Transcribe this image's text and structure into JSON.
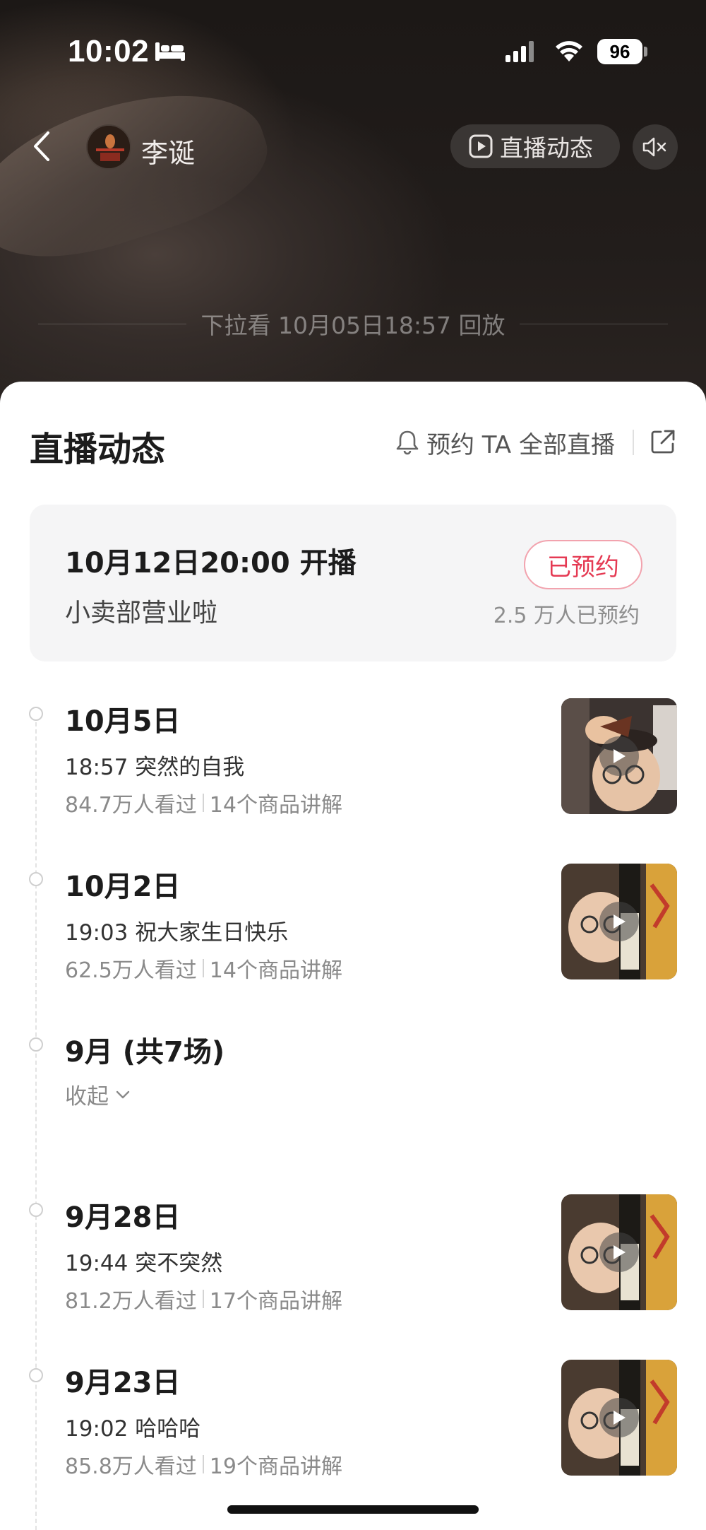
{
  "status_bar": {
    "time": "10:02",
    "battery": "96"
  },
  "header": {
    "streamer_name": "李诞",
    "live_dynamics_button": "直播动态",
    "replay_hint": "下拉看 10月05日18:57 回放"
  },
  "sheet": {
    "title": "直播动态",
    "remind_all": "预约 TA 全部直播",
    "upcoming": {
      "time": "10月12日20:00 开播",
      "title": "小卖部营业啦",
      "reserved_label": "已预约",
      "reserved_count": "2.5 万人已预约"
    },
    "timeline": [
      {
        "date": "10月5日",
        "title": "18:57 突然的自我",
        "views": "84.7万人看过",
        "products": "14个商品讲解"
      },
      {
        "date": "10月2日",
        "title": "19:03 祝大家生日快乐",
        "views": "62.5万人看过",
        "products": "14个商品讲解"
      },
      {
        "date": "9月 (共7场)",
        "collapse": "收起"
      },
      {
        "date": "9月28日",
        "title": "19:44 突不突然",
        "views": "81.2万人看过",
        "products": "17个商品讲解"
      },
      {
        "date": "9月23日",
        "title": "19:02 哈哈哈",
        "views": "85.8万人看过",
        "products": "19个商品讲解"
      }
    ]
  },
  "colors": {
    "accent_red": "#e53a53",
    "hero_bg": "#1e1a18",
    "card_bg": "#f5f5f6"
  }
}
